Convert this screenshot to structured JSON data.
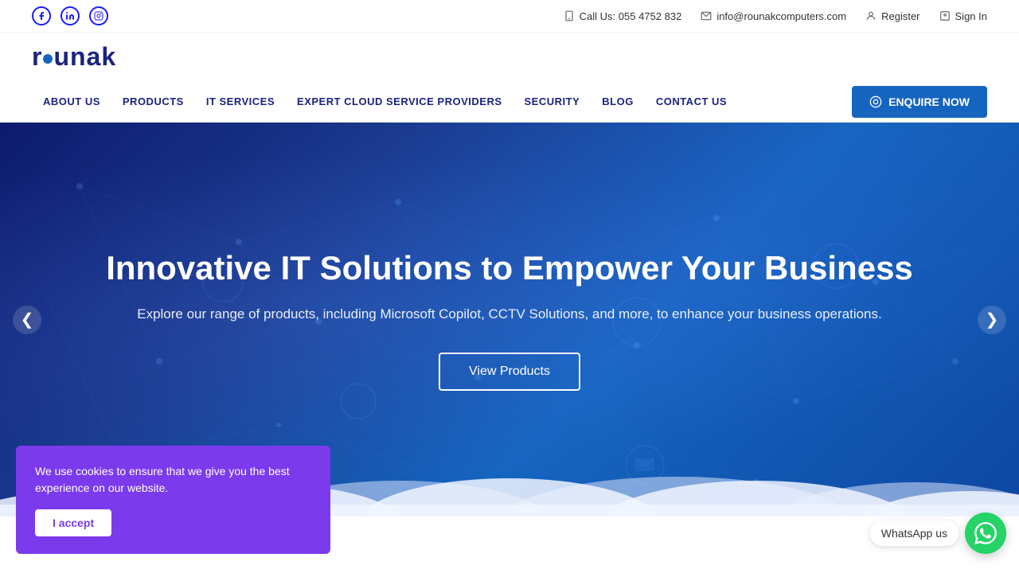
{
  "topbar": {
    "social": [
      {
        "name": "facebook",
        "label": "f"
      },
      {
        "name": "linkedin",
        "label": "in"
      },
      {
        "name": "instagram",
        "label": "ig"
      }
    ],
    "phone_icon": "📱",
    "phone": "Call Us: 055 4752 832",
    "email_icon": "✉",
    "email": "info@rounakcomputers.com",
    "register_label": "Register",
    "signin_label": "Sign In"
  },
  "header": {
    "logo_text_1": "r",
    "logo_text_2": "unak"
  },
  "nav": {
    "links": [
      {
        "label": "ABOUT US"
      },
      {
        "label": "PRODUCTS"
      },
      {
        "label": "IT SERVICES"
      },
      {
        "label": "EXPERT CLOUD SERVICE PROVIDERS"
      },
      {
        "label": "SECURITY"
      },
      {
        "label": "BLOG"
      },
      {
        "label": "CONTACT US"
      }
    ],
    "enquire_label": "ENQUIRE NOW"
  },
  "hero": {
    "title": "Innovative IT Solutions to Empower Your Business",
    "subtitle": "Explore our range of products, including Microsoft Copilot, CCTV Solutions, and more, to enhance your business operations.",
    "cta_label": "View Products",
    "arrow_left": "❮",
    "arrow_right": "❯"
  },
  "cookie": {
    "message": "We use cookies to ensure that we give you the best experience on our website.",
    "accept_label": "I accept"
  },
  "whatsapp": {
    "label": "WhatsApp us"
  }
}
